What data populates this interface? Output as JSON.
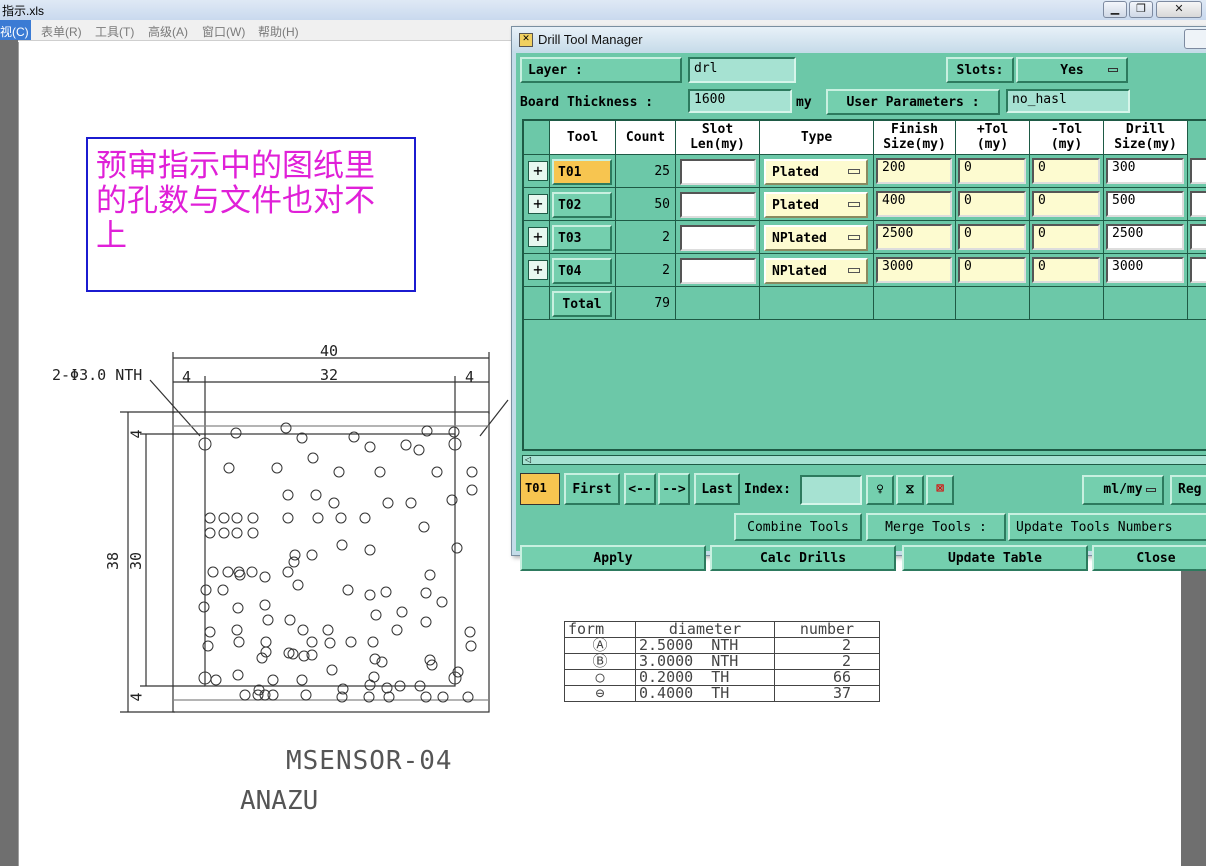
{
  "excel": {
    "title": "指示.xls",
    "menu": [
      "视(C)",
      "表单(R)",
      "工具(T)",
      "高级(A)",
      "窗口(W)",
      "帮助(H)"
    ]
  },
  "note": {
    "text": "预审指示中的图纸里的孔数与文件也对不上"
  },
  "drawing": {
    "dims": {
      "top_total": "40",
      "left_margin": "4",
      "inner": "32",
      "right_margin": "4",
      "hole_label": "2-Φ3.0 NTH",
      "height_total": "38",
      "height_inner": "30",
      "top_edge": "4",
      "bottom_edge": "4"
    },
    "part_name": "MSENSOR-04",
    "company": "ANAZU"
  },
  "hole_table": {
    "headers": [
      "form",
      "diameter",
      "number"
    ],
    "rows": [
      {
        "form": "Ⓐ",
        "diameter": "2.5000",
        "kind": "NTH",
        "number": "2"
      },
      {
        "form": "Ⓑ",
        "diameter": "3.0000",
        "kind": "NTH",
        "number": "2"
      },
      {
        "form": "○",
        "diameter": "0.2000",
        "kind": "TH",
        "number": "66"
      },
      {
        "form": "⊖",
        "diameter": "0.4000",
        "kind": "TH",
        "number": "37"
      }
    ]
  },
  "dtm": {
    "title": "Drill Tool Manager",
    "layer_label": "Layer        :",
    "layer_value": "drl",
    "slots_label": "Slots:",
    "slots_value": "Yes",
    "thickness_label": "Board Thickness :",
    "thickness_value": "1600",
    "thickness_unit": "my",
    "user_params_label": "User Parameters :",
    "user_params_value": "no_hasl",
    "columns": [
      "Tool",
      "Count",
      "Slot\nLen(my)",
      "Type",
      "Finish\nSize(my)",
      "+Tol\n(my)",
      "-Tol\n(my)",
      "Drill\nSize(my)"
    ],
    "rows": [
      {
        "tool": "T01",
        "count": "25",
        "slot": "",
        "type": "Plated",
        "finish": "200",
        "ptol": "0",
        "ntol": "0",
        "drill": "300"
      },
      {
        "tool": "T02",
        "count": "50",
        "slot": "",
        "type": "Plated",
        "finish": "400",
        "ptol": "0",
        "ntol": "0",
        "drill": "500"
      },
      {
        "tool": "T03",
        "count": "2",
        "slot": "",
        "type": "NPlated",
        "finish": "2500",
        "ptol": "0",
        "ntol": "0",
        "drill": "2500"
      },
      {
        "tool": "T04",
        "count": "2",
        "slot": "",
        "type": "NPlated",
        "finish": "3000",
        "ptol": "0",
        "ntol": "0",
        "drill": "3000"
      }
    ],
    "total_label": "Total",
    "total_count": "79",
    "current_tool": "T01",
    "nav": {
      "first": "First",
      "prev": "<--",
      "next": "-->",
      "last": "Last",
      "index_label": "Index:",
      "index_value": "",
      "units": "ml/my",
      "reg": "Reg"
    },
    "combine_tools": "Combine Tools",
    "merge_tools": "Merge Tools :",
    "update_numbers": "Update Tools Numbers",
    "apply": "Apply",
    "calc_drills": "Calc Drills",
    "update_table": "Update Table",
    "close": "Close"
  }
}
